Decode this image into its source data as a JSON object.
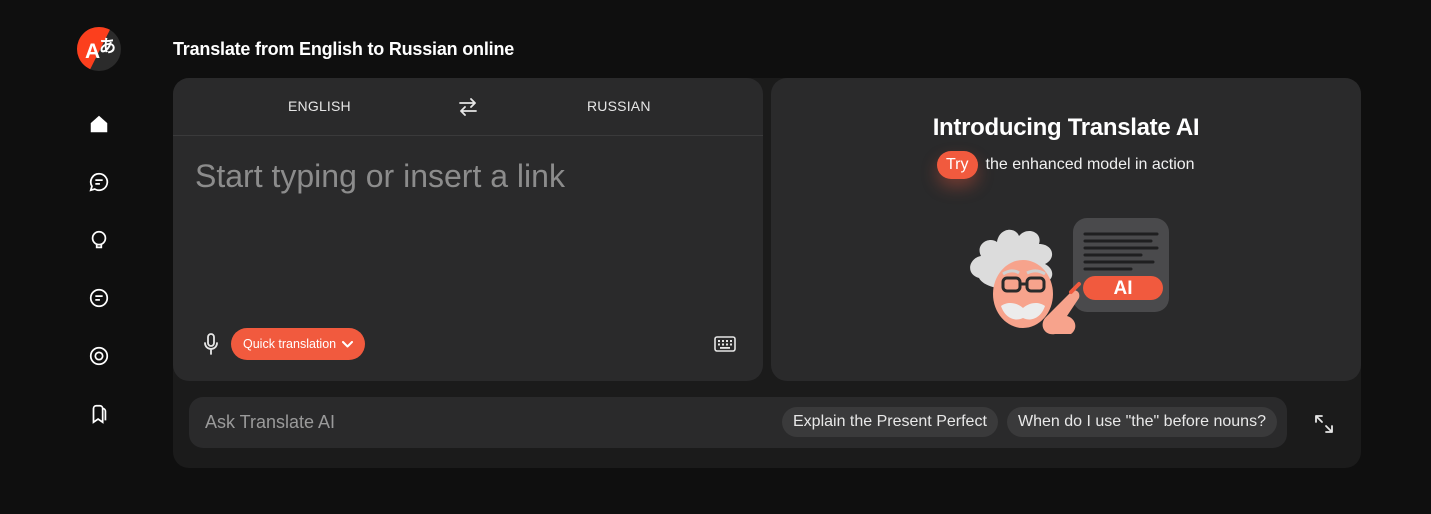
{
  "page": {
    "title": "Translate from English to Russian online"
  },
  "logo": {
    "glyph_latin": "A",
    "glyph_kana": "あ"
  },
  "sidebar": {
    "items": [
      {
        "name": "home",
        "icon": "home-icon"
      },
      {
        "name": "chat",
        "icon": "chat-bubbles-icon"
      },
      {
        "name": "lightbulb",
        "icon": "lightbulb-icon"
      },
      {
        "name": "text",
        "icon": "text-message-icon"
      },
      {
        "name": "camera",
        "icon": "camera-lens-icon"
      },
      {
        "name": "bookmarks",
        "icon": "bookmarks-icon"
      }
    ]
  },
  "translator": {
    "source_lang": "ENGLISH",
    "target_lang": "RUSSIAN",
    "swap_icon": "swap-arrows-icon",
    "input_placeholder": "Start typing or insert a link",
    "input_value": "",
    "mic_icon": "microphone-icon",
    "mode_label": "Quick translation",
    "mode_icon": "chevron-down-icon",
    "keyboard_icon": "keyboard-icon"
  },
  "promo": {
    "title": "Introducing Translate AI",
    "try_label": "Try",
    "subtitle": "the enhanced model in action",
    "badge": "AI"
  },
  "ask": {
    "placeholder": "Ask Translate AI",
    "value": "",
    "suggestions": [
      "Explain the Present Perfect",
      "When do I use \"the\" before nouns?"
    ],
    "expand_icon": "expand-arrows-icon"
  },
  "colors": {
    "accent": "#f15a3e",
    "background": "#0f0f0f",
    "panel": "#2a2a2b",
    "outer_panel": "#1b1b1b",
    "logo_red": "#fc3f1d"
  }
}
